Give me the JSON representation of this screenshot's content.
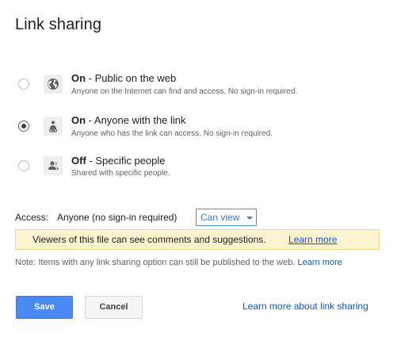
{
  "dialog": {
    "title": "Link sharing"
  },
  "options": [
    {
      "state": "On",
      "separator": " - ",
      "label": "Public on the web",
      "description": "Anyone on the Internet can find and access. No sign-in required.",
      "icon": "globe-icon",
      "selected": false
    },
    {
      "state": "On",
      "separator": " - ",
      "label": "Anyone with the link",
      "description": "Anyone who has the link can access. No sign-in required.",
      "icon": "person-link-icon",
      "selected": true
    },
    {
      "state": "Off",
      "separator": " - ",
      "label": "Specific people",
      "description": "Shared with specific people.",
      "icon": "person-icon",
      "selected": false
    }
  ],
  "access": {
    "label": "Access:",
    "value": "Anyone (no sign-in required)",
    "permission": "Can view"
  },
  "notice": {
    "text": "Viewers of this file can see comments and suggestions.",
    "link": "Learn more"
  },
  "note": {
    "text": "Note: Items with any link sharing option can still be published to the web.",
    "link": "Learn more"
  },
  "buttons": {
    "save": "Save",
    "cancel": "Cancel",
    "learn_more": "Learn more about link sharing"
  },
  "colors": {
    "accent": "#4a8af4",
    "link": "#1155cc",
    "notice_bg": "#fcf3cf"
  }
}
